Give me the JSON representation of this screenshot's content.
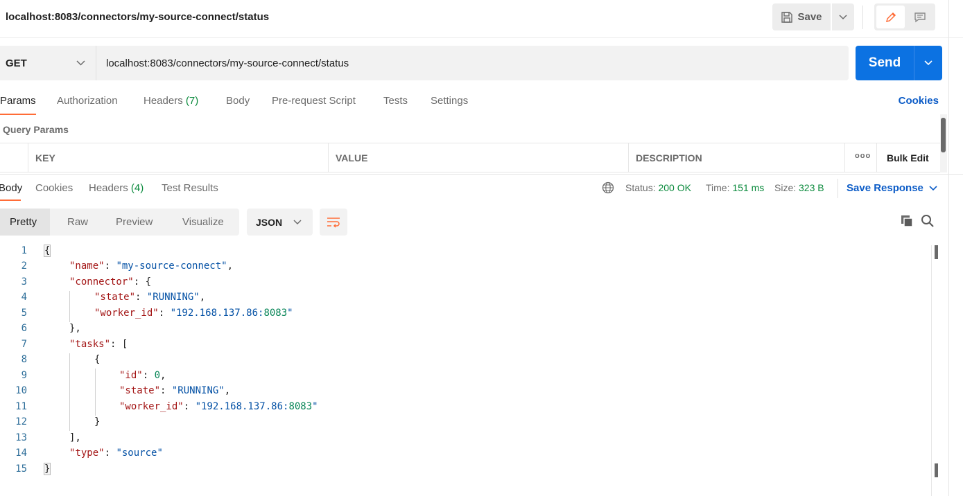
{
  "request": {
    "title": "localhost:8083/connectors/my-source-connect/status",
    "method": "GET",
    "url": "localhost:8083/connectors/my-source-connect/status",
    "save_label": "Save",
    "send_label": "Send"
  },
  "request_tabs": [
    {
      "label": "Params",
      "active": true
    },
    {
      "label": "Authorization"
    },
    {
      "label": "Headers",
      "count": "(7)"
    },
    {
      "label": "Body"
    },
    {
      "label": "Pre-request Script"
    },
    {
      "label": "Tests"
    },
    {
      "label": "Settings"
    }
  ],
  "cookies_label": "Cookies",
  "query_params": {
    "title": "Query Params",
    "columns": [
      "KEY",
      "VALUE",
      "DESCRIPTION"
    ],
    "more_label": "ooo",
    "bulk_edit_label": "Bulk Edit"
  },
  "response_tabs": [
    {
      "label": "Body",
      "active": true
    },
    {
      "label": "Cookies"
    },
    {
      "label": "Headers",
      "count": "(4)"
    },
    {
      "label": "Test Results"
    }
  ],
  "response_status": {
    "status_label": "Status:",
    "status_value": "200 OK",
    "time_label": "Time:",
    "time_value": "151 ms",
    "size_label": "Size:",
    "size_value": "323 B",
    "save_response_label": "Save Response"
  },
  "format_tabs": [
    "Pretty",
    "Raw",
    "Preview",
    "Visualize"
  ],
  "language": "JSON",
  "code_lines": [
    {
      "n": "1",
      "t": "{"
    },
    {
      "n": "2",
      "t": "\"name\": \"my-source-connect\","
    },
    {
      "n": "3",
      "t": "\"connector\": {"
    },
    {
      "n": "4",
      "t": "\"state\": \"RUNNING\","
    },
    {
      "n": "5",
      "t": "\"worker_id\": \"192.168.137.86:8083\""
    },
    {
      "n": "6",
      "t": "},"
    },
    {
      "n": "7",
      "t": "\"tasks\": ["
    },
    {
      "n": "8",
      "t": "{"
    },
    {
      "n": "9",
      "t": "\"id\": 0,"
    },
    {
      "n": "10",
      "t": "\"state\": \"RUNNING\","
    },
    {
      "n": "11",
      "t": "\"worker_id\": \"192.168.137.86:8083\""
    },
    {
      "n": "12",
      "t": "}"
    },
    {
      "n": "13",
      "t": "],"
    },
    {
      "n": "14",
      "t": "\"type\": \"source\""
    },
    {
      "n": "15",
      "t": "}"
    }
  ],
  "colors": {
    "accent": "#ff6c37",
    "send_button": "#0c72e2",
    "link": "#0c5cc7",
    "success": "#0a8a3c",
    "json_key": "#a31515",
    "json_string": "#0451a5",
    "json_number": "#098658"
  }
}
